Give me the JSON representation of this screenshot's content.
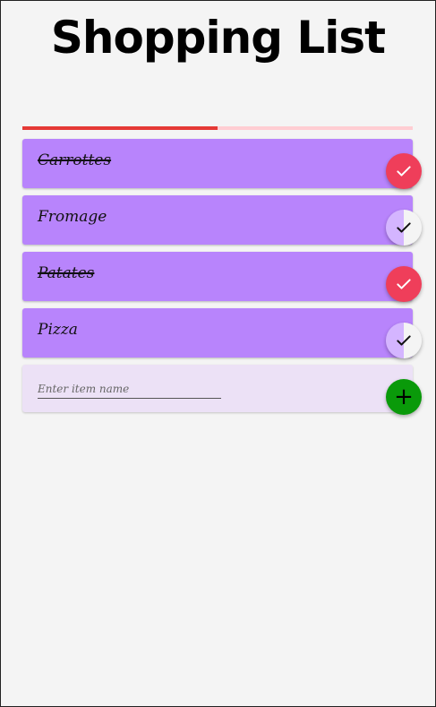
{
  "page": {
    "title": "Shopping List"
  },
  "progress": {
    "done_fraction": 0.5,
    "fill_color": "#e53935",
    "track_color": "#ffcdd2"
  },
  "items": [
    {
      "label": "Carrottes",
      "checked": true
    },
    {
      "label": "Fromage",
      "checked": false
    },
    {
      "label": "Patates",
      "checked": true
    },
    {
      "label": "Pizza",
      "checked": false
    }
  ],
  "add_item": {
    "placeholder": "Enter item name",
    "value": "",
    "button_icon": "plus-icon",
    "button_glyph": "+",
    "button_color": "#0a9a0a"
  },
  "colors": {
    "item_background": "#b884fc",
    "checked_button": "#ef3e5a",
    "unchecked_button": "#d4b5ff",
    "add_row_background": "#ece1f6"
  },
  "icons": {
    "check": "check-icon"
  }
}
